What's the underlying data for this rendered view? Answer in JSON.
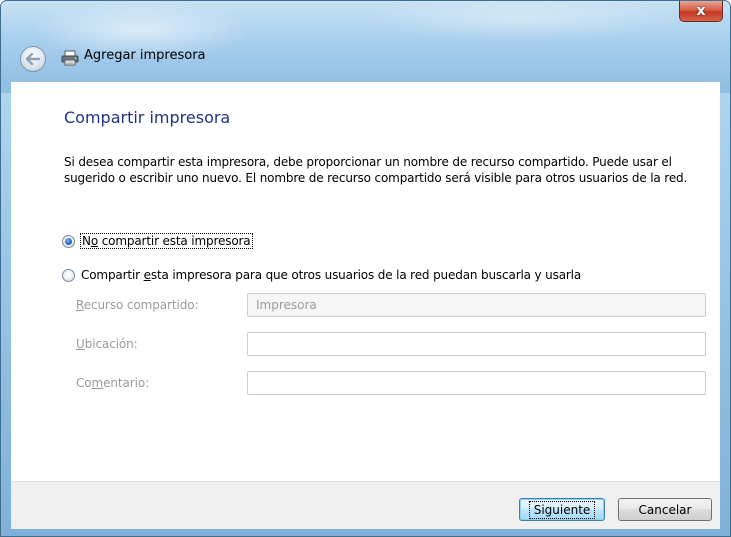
{
  "window": {
    "close_label": "x"
  },
  "header": {
    "title": "Agregar impresora",
    "back_icon": "back-arrow-icon",
    "printer_icon": "printer-icon"
  },
  "main": {
    "heading": "Compartir impresora",
    "description": "Si desea compartir esta impresora, debe proporcionar un nombre de recurso compartido. Puede usar el sugerido o escribir uno nuevo. El nombre de recurso compartido será visible para otros usuarios de la red.",
    "options": {
      "no_share": {
        "pre": "N",
        "accel": "o",
        "post": " compartir esta impresora",
        "selected": true
      },
      "share": {
        "pre": "Compartir ",
        "accel": "e",
        "post": "sta impresora para que otros usuarios de la red puedan buscarla y usarla",
        "selected": false
      }
    },
    "fields": {
      "share_name": {
        "label_accel": "R",
        "label_rest": "ecurso compartido:",
        "value": "Impresora"
      },
      "location": {
        "label_accel": "U",
        "label_rest": "bicación:",
        "value": ""
      },
      "comment": {
        "label_pre": "Co",
        "label_accel": "m",
        "label_rest": "entario:",
        "value": ""
      }
    }
  },
  "footer": {
    "next_label": "Siguiente",
    "cancel_label": "Cancelar"
  },
  "colors": {
    "heading": "#1e3287",
    "disabled_text": "#9b9b9b",
    "footer_bg": "#f0f0f0"
  }
}
